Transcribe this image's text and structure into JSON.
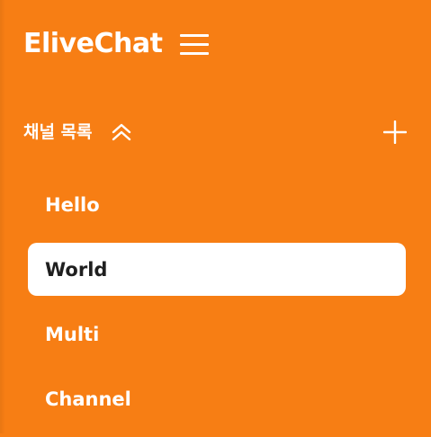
{
  "app": {
    "title": "EliveChat"
  },
  "header": {
    "menu_icon": "hamburger-menu-icon"
  },
  "channels_section": {
    "title": "채널 목록",
    "collapse_icon": "double-chevron-up-icon",
    "add_icon": "plus-icon"
  },
  "channels": [
    {
      "label": "Hello",
      "active": false
    },
    {
      "label": "World",
      "active": true
    },
    {
      "label": "Multi",
      "active": false
    },
    {
      "label": "Channel",
      "active": false
    }
  ],
  "colors": {
    "sidebar_bg": "#F77E14",
    "active_item_bg": "#FFFFFF",
    "active_item_text": "#1F1F1F",
    "text": "#FFFFFF"
  }
}
